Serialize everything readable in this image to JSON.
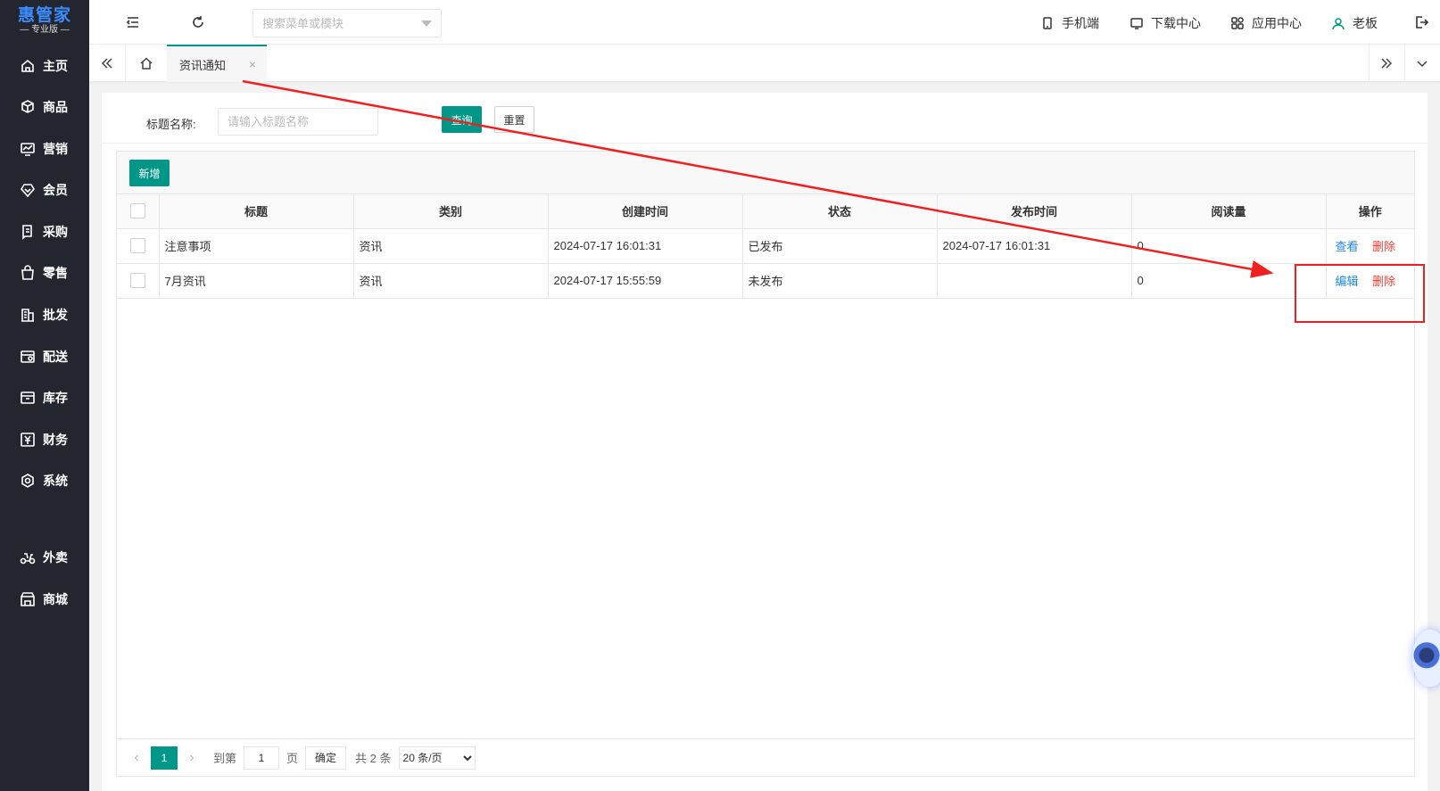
{
  "logo": {
    "main": "惠管家",
    "sub": "— 专业版 —"
  },
  "sidebar": {
    "items": [
      {
        "label": "主页",
        "icon": "home-icon"
      },
      {
        "label": "商品",
        "icon": "box-icon"
      },
      {
        "label": "营销",
        "icon": "chart-icon"
      },
      {
        "label": "会员",
        "icon": "diamond-icon"
      },
      {
        "label": "采购",
        "icon": "document-icon"
      },
      {
        "label": "零售",
        "icon": "shopping-bag-icon"
      },
      {
        "label": "批发",
        "icon": "building-icon"
      },
      {
        "label": "配送",
        "icon": "delivery-icon"
      },
      {
        "label": "库存",
        "icon": "warehouse-icon"
      },
      {
        "label": "财务",
        "icon": "yen-icon"
      },
      {
        "label": "系统",
        "icon": "settings-icon"
      },
      {
        "label": "外卖",
        "icon": "scooter-icon"
      },
      {
        "label": "商城",
        "icon": "store-icon"
      }
    ]
  },
  "header": {
    "search_placeholder": "搜索菜单或模块",
    "links": [
      {
        "label": "手机端",
        "icon": "phone-icon"
      },
      {
        "label": "下载中心",
        "icon": "monitor-icon"
      },
      {
        "label": "应用中心",
        "icon": "apps-icon"
      },
      {
        "label": "老板",
        "icon": "user-icon"
      }
    ]
  },
  "tabs": {
    "active_label": "资讯通知",
    "close": "×"
  },
  "filter": {
    "title_label": "标题名称:",
    "title_placeholder": "请输入标题名称",
    "query_button": "查询",
    "reset_button": "重置"
  },
  "toolbar": {
    "add_button": "新增"
  },
  "table": {
    "columns": [
      "标题",
      "类别",
      "创建时间",
      "状态",
      "发布时间",
      "阅读量",
      "操作"
    ],
    "rows": [
      {
        "title": "注意事项",
        "category": "资讯",
        "created": "2024-07-17 16:01:31",
        "status": "已发布",
        "published": "2024-07-17 16:01:31",
        "reads": "0",
        "op1": "查看",
        "op2": "删除"
      },
      {
        "title": "7月资讯",
        "category": "资讯",
        "created": "2024-07-17 15:55:59",
        "status": "未发布",
        "published": "",
        "reads": "0",
        "op1": "编辑",
        "op2": "删除"
      }
    ]
  },
  "pager": {
    "prev": "‹",
    "current": "1",
    "next": "›",
    "goto_label": "到第",
    "goto_value": "1",
    "page_label": "页",
    "confirm": "确定",
    "total": "共 2 条",
    "page_size": "20 条/页"
  },
  "colors": {
    "primary": "#009688",
    "sidebar_bg": "#23262e",
    "link_blue": "#1e88e5",
    "danger": "#ff3b30",
    "annotation": "#f02020"
  }
}
